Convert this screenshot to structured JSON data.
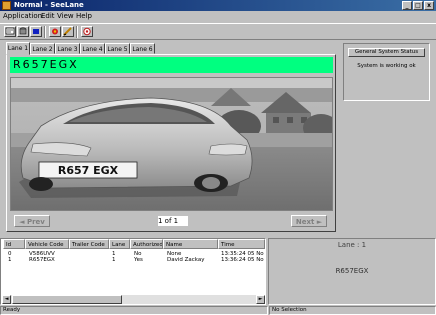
{
  "window": {
    "title": "Normal - SeeLane",
    "minimize": "_",
    "maximize": "□",
    "close": "x"
  },
  "menu": [
    {
      "label": "Application"
    },
    {
      "label": "Edit"
    },
    {
      "label": "View"
    },
    {
      "label": "Help"
    }
  ],
  "toolbar": {
    "icons": [
      "settings-icon",
      "database-icon",
      "stop-icon",
      "pen-icon",
      "check-icon",
      "camera-icon"
    ]
  },
  "tabs": [
    {
      "label": "Lane 1"
    },
    {
      "label": "Lane 2"
    },
    {
      "label": "Lane 3"
    },
    {
      "label": "Lane 4"
    },
    {
      "label": "Lane 5"
    },
    {
      "label": "Lane 6"
    }
  ],
  "active_tab": 0,
  "capture": {
    "plate": "R657EGX",
    "car_plate_text": "R657 EGX",
    "prev_label": "◄ Prev",
    "next_label": "Next ►",
    "page_display": "1  of  1"
  },
  "system_status": {
    "heading": "General System Status",
    "message": "System is working ok"
  },
  "events": {
    "columns": [
      "Id",
      "Vehicle Code",
      "Trailer Code",
      "Lane",
      "Authorized",
      "Name",
      "Time"
    ],
    "rows": [
      [
        "0",
        "V586UVV",
        "",
        "1",
        "No",
        "None",
        "13:35:24  05 No"
      ],
      [
        "1",
        "R657EGX",
        "",
        "1",
        "Yes",
        "David Zackay",
        "13:36:24  05 No"
      ]
    ]
  },
  "lane_info": {
    "title": "Lane : 1",
    "plate": "R657EGX"
  },
  "status_bar": {
    "left": "Ready",
    "right": "No Selection"
  }
}
